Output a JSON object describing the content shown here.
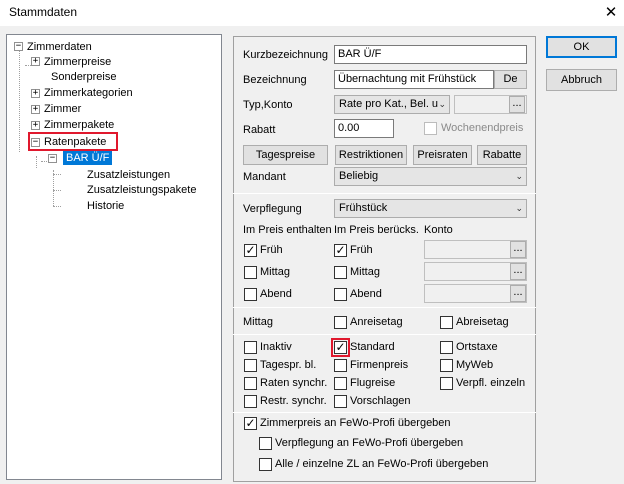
{
  "window": {
    "title": "Stammdaten"
  },
  "tree": {
    "root": "Zimmerdaten",
    "items": {
      "zimmerpreise": "Zimmerpreise",
      "sonderpreise": "Sonderpreise",
      "zimmerkategorien": "Zimmerkategorien",
      "zimmer": "Zimmer",
      "zimmerpakete": "Zimmerpakete",
      "ratenpakete": "Ratenpakete",
      "bar": "BAR Ü/F",
      "zusatzleistungen": "Zusatzleistungen",
      "zusatzleistungspakete": "Zusatzleistungspakete",
      "historie": "Historie"
    }
  },
  "form": {
    "kurzbezeichnung_label": "Kurzbezeichnung",
    "kurzbezeichnung_value": "BAR Ü/F",
    "bezeichnung_label": "Bezeichnung",
    "bezeichnung_value": "Übernachtung mit Frühstück",
    "lang_button": "De",
    "typkonto_label": "Typ,Konto",
    "typ_value": "Rate pro Kat., Bel. u",
    "rabatt_label": "Rabatt",
    "rabatt_value": "0.00",
    "wochenendpreis_label": "Wochenendpreis",
    "buttons": {
      "tagespreise": "Tagespreise",
      "restriktionen": "Restriktionen",
      "preisraten": "Preisraten",
      "rabatte": "Rabatte"
    },
    "mandant_label": "Mandant",
    "mandant_value": "Beliebig",
    "verpflegung_label": "Verpflegung",
    "verpflegung_value": "Frühstück",
    "col_enthalten": "Im Preis enthalten",
    "col_beruecks": "Im Preis berücks.",
    "col_konto": "Konto",
    "meals": {
      "frueh": "Früh",
      "mittag": "Mittag",
      "abend": "Abend"
    },
    "mittag_row_label": "Mittag",
    "anreisetag": "Anreisetag",
    "abreisetag": "Abreisetag",
    "flags": {
      "inaktiv": "Inaktiv",
      "standard": "Standard",
      "ortstaxe": "Ortstaxe",
      "tagespr_bl": "Tagespr. bl.",
      "firmenpreis": "Firmenpreis",
      "myweb": "MyWeb",
      "raten_synchr": "Raten synchr.",
      "flugreise": "Flugreise",
      "verpfl_einzeln": "Verpfl. einzeln",
      "restr_synchr": "Restr. synchr.",
      "vorschlagen": "Vorschlagen"
    },
    "fewo": {
      "zimmerpreis": "Zimmerpreis an FeWo-Profi übergeben",
      "verpflegung": "Verpflegung an FeWo-Profi übergeben",
      "zl": "Alle / einzelne ZL an FeWo-Profi übergeben"
    }
  },
  "actions": {
    "ok": "OK",
    "abbruch": "Abbruch"
  },
  "glyphs": {
    "check": "✓",
    "close": "✕",
    "ellipsis": "...",
    "dropdown": "⌄",
    "collapse": "−",
    "expand": "+"
  },
  "colors": {
    "selection": "#0078d7",
    "highlight_box": "#e0182d"
  }
}
